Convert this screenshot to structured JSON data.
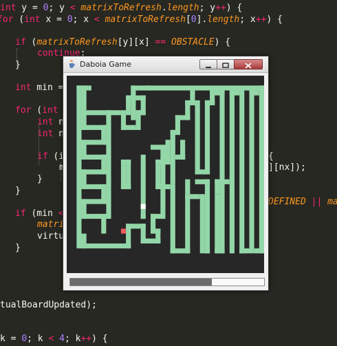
{
  "editor": {
    "lines": [
      [
        [
          "kw",
          "int"
        ],
        [
          "pl",
          " y = "
        ],
        [
          "nm",
          "0"
        ],
        [
          "pl",
          "; y "
        ],
        [
          "op",
          "<"
        ],
        [
          "pl",
          " "
        ],
        [
          "it",
          "matrixToRefresh"
        ],
        [
          "pl",
          "."
        ],
        [
          "it",
          "length"
        ],
        [
          "pl",
          "; y"
        ],
        [
          "op",
          "++"
        ],
        [
          "pl",
          ") {"
        ]
      ],
      [
        [
          "kw",
          "for"
        ],
        [
          "pl",
          " ("
        ],
        [
          "kw",
          "int"
        ],
        [
          "pl",
          " x = "
        ],
        [
          "nm",
          "0"
        ],
        [
          "pl",
          "; x "
        ],
        [
          "op",
          "<"
        ],
        [
          "pl",
          " "
        ],
        [
          "it",
          "matrixToRefresh"
        ],
        [
          "pl",
          "["
        ],
        [
          "nm",
          "0"
        ],
        [
          "pl",
          "]."
        ],
        [
          "it",
          "length"
        ],
        [
          "pl",
          "; x"
        ],
        [
          "op",
          "++"
        ],
        [
          "pl",
          ") {"
        ]
      ],
      [],
      [
        [
          "kw",
          "if"
        ],
        [
          "pl",
          " ("
        ],
        [
          "it",
          "matrixToRefresh"
        ],
        [
          "pl",
          "[y][x] "
        ],
        [
          "op",
          "=="
        ],
        [
          "pl",
          " "
        ],
        [
          "it",
          "OBSTACLE"
        ],
        [
          "pl",
          ") {"
        ]
      ],
      [
        [
          "kw",
          "continue"
        ],
        [
          "pl",
          ";"
        ]
      ],
      [
        [
          "pl",
          "}"
        ]
      ],
      [],
      [
        [
          "kw",
          "int"
        ],
        [
          "pl",
          " min = "
        ]
      ],
      [],
      [
        [
          "kw",
          "for"
        ],
        [
          "pl",
          " ("
        ],
        [
          "kw",
          "int"
        ]
      ],
      [
        [
          "kw",
          "int"
        ],
        [
          "pl",
          " n"
        ]
      ],
      [
        [
          "kw",
          "int"
        ],
        [
          "pl",
          " n"
        ]
      ],
      [],
      [
        [
          "kw",
          "if"
        ],
        [
          "pl",
          " (i"
        ]
      ],
      [
        [
          "pl",
          "m"
        ]
      ],
      [
        [
          "pl",
          "}"
        ]
      ],
      [
        [
          "pl",
          "}"
        ]
      ],
      [],
      [
        [
          "kw",
          "if"
        ],
        [
          "pl",
          " (min "
        ],
        [
          "op",
          "<"
        ]
      ],
      [
        [
          "it",
          "matri"
        ]
      ],
      [
        [
          "pl",
          "virtu"
        ]
      ],
      [
        [
          "pl",
          "}"
        ]
      ],
      [],
      [],
      [
        [
          "pl",
          "tualBoardUpdated);"
        ]
      ],
      [],
      [
        [
          "pl",
          "k = "
        ],
        [
          "nm",
          "0"
        ],
        [
          "pl",
          "; k "
        ],
        [
          "op",
          "<"
        ],
        [
          "pl",
          " "
        ],
        [
          "nm",
          "4"
        ],
        [
          "pl",
          "; k"
        ],
        [
          "op",
          "++"
        ],
        [
          "pl",
          ") {"
        ]
      ]
    ],
    "right_fragments": [
      {
        "row": 11,
        "tokens": [
          [
            "pl",
            "{"
          ]
        ]
      },
      {
        "row": 12,
        "tokens": [
          [
            "pl",
            "][nx]);"
          ]
        ]
      },
      {
        "row": 15,
        "tokens": [
          [
            "it",
            "DEFINED"
          ],
          [
            "pl",
            " "
          ],
          [
            "op",
            "||"
          ],
          [
            "pl",
            " "
          ],
          [
            "it",
            "ma"
          ]
        ]
      }
    ]
  },
  "window": {
    "title": "Daboia Game",
    "icon": "java-cup-icon",
    "buttons": [
      "minimize-icon",
      "maximize-icon",
      "close-icon"
    ]
  },
  "game": {
    "grid_size": 40,
    "colors": {
      "background": "#272727",
      "wall": "#93d6a8",
      "head": "#ffffff",
      "food": "#f05a5a"
    },
    "walls": [
      [
        2,
        2,
        1,
        33
      ],
      [
        2,
        2,
        3,
        1
      ],
      [
        3,
        2,
        1,
        6
      ],
      [
        3,
        7,
        5,
        1
      ],
      [
        3,
        10,
        5,
        1
      ],
      [
        3,
        13,
        5,
        1
      ],
      [
        3,
        16,
        5,
        1
      ],
      [
        3,
        19,
        5,
        1
      ],
      [
        3,
        22,
        5,
        1
      ],
      [
        3,
        25,
        5,
        1
      ],
      [
        3,
        28,
        5,
        1
      ],
      [
        3,
        7,
        1,
        4
      ],
      [
        7,
        10,
        1,
        4
      ],
      [
        3,
        13,
        1,
        4
      ],
      [
        7,
        16,
        1,
        4
      ],
      [
        3,
        19,
        1,
        4
      ],
      [
        7,
        22,
        1,
        4
      ],
      [
        3,
        25,
        1,
        4
      ],
      [
        7,
        28,
        1,
        4
      ],
      [
        8,
        7,
        1,
        22
      ],
      [
        8,
        7,
        3,
        1
      ],
      [
        11,
        7,
        1,
        4
      ],
      [
        11,
        10,
        3,
        1
      ],
      [
        14,
        7,
        1,
        4
      ],
      [
        14,
        7,
        2,
        1
      ],
      [
        15,
        4,
        1,
        4
      ],
      [
        12,
        4,
        4,
        1
      ],
      [
        12,
        4,
        1,
        4
      ],
      [
        3,
        32,
        1,
        3
      ],
      [
        3,
        34,
        10,
        1
      ],
      [
        12,
        30,
        1,
        5
      ],
      [
        12,
        30,
        4,
        1
      ],
      [
        15,
        30,
        1,
        4
      ],
      [
        15,
        33,
        4,
        1
      ],
      [
        18,
        31,
        1,
        3
      ],
      [
        17,
        31,
        2,
        1
      ],
      [
        17,
        28,
        1,
        4
      ],
      [
        17,
        28,
        3,
        1
      ],
      [
        19,
        14,
        1,
        15
      ],
      [
        17,
        14,
        3,
        1
      ],
      [
        11,
        17,
        1,
        6
      ],
      [
        11,
        22,
        2,
        1
      ],
      [
        12,
        17,
        1,
        6
      ],
      [
        11,
        17,
        2,
        1
      ],
      [
        15,
        16,
        1,
        13
      ],
      [
        15,
        28,
        1,
        1
      ],
      [
        13,
        2,
        1,
        7
      ],
      [
        13,
        2,
        27,
        1
      ],
      [
        39,
        2,
        1,
        34
      ],
      [
        38,
        35,
        2,
        1
      ],
      [
        21,
        22,
        1,
        14
      ],
      [
        21,
        35,
        4,
        1
      ],
      [
        24,
        24,
        1,
        12
      ],
      [
        24,
        24,
        3,
        1
      ],
      [
        27,
        24,
        1,
        12
      ],
      [
        16,
        2,
        1,
        1
      ],
      [
        21,
        11,
        1,
        11
      ],
      [
        21,
        11,
        2,
        1
      ],
      [
        22,
        8,
        1,
        4
      ],
      [
        22,
        8,
        3,
        1
      ],
      [
        24,
        5,
        1,
        4
      ],
      [
        24,
        5,
        2,
        1
      ],
      [
        25,
        3,
        1,
        3
      ],
      [
        18,
        22,
        3,
        1
      ],
      [
        18,
        17,
        1,
        6
      ],
      [
        18,
        17,
        3,
        1
      ],
      [
        20,
        13,
        1,
        5
      ],
      [
        26,
        5,
        1,
        15
      ],
      [
        26,
        19,
        3,
        1
      ],
      [
        28,
        5,
        1,
        15
      ],
      [
        28,
        5,
        2,
        1
      ],
      [
        29,
        3,
        1,
        3
      ],
      [
        29,
        3,
        3,
        1
      ],
      [
        31,
        3,
        1,
        33
      ],
      [
        30,
        24,
        1,
        12
      ],
      [
        30,
        35,
        2,
        1
      ],
      [
        33,
        3,
        1,
        33
      ],
      [
        33,
        3,
        2,
        1
      ],
      [
        35,
        3,
        1,
        33
      ],
      [
        35,
        35,
        2,
        1
      ],
      [
        37,
        3,
        1,
        33
      ],
      [
        37,
        3,
        2,
        1
      ],
      [
        26,
        21,
        3,
        1
      ],
      [
        28,
        21,
        1,
        15
      ],
      [
        28,
        35,
        1,
        1
      ],
      [
        24,
        21,
        1,
        3
      ],
      [
        30,
        21,
        1,
        3
      ],
      [
        30,
        21,
        3,
        1
      ],
      [
        23,
        13,
        1,
        4
      ],
      [
        22,
        16,
        2,
        1
      ]
    ],
    "head": [
      15,
      26
    ],
    "food": [
      11,
      31
    ]
  },
  "progress": {
    "value": 0.73
  }
}
